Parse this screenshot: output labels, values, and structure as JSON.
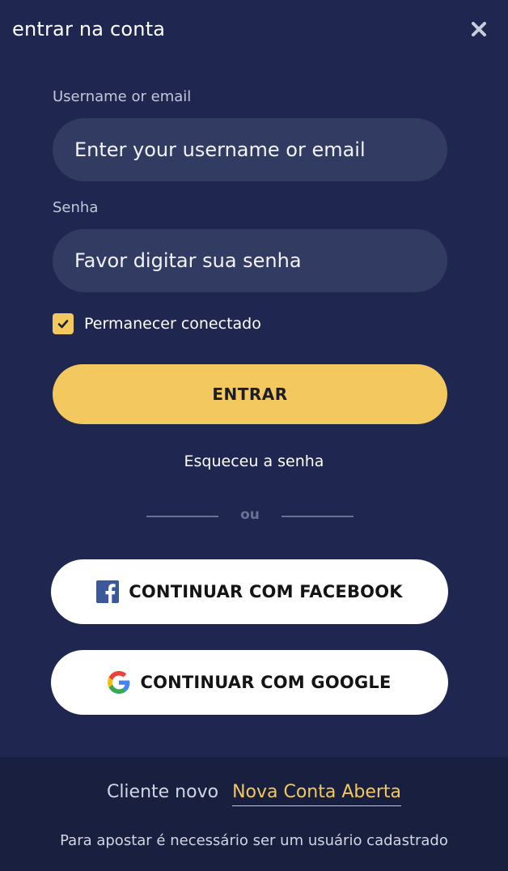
{
  "header": {
    "title": "entrar na conta",
    "close_icon": "close-icon"
  },
  "form": {
    "username_label": "Username or email",
    "username_placeholder": "Enter your username or email",
    "password_label": "Senha",
    "password_placeholder": "Favor digitar sua senha",
    "remember_label": "Permanecer conectado",
    "remember_checked": true,
    "submit_label": "ENTRAR",
    "forgot_label": "Esqueceu a senha"
  },
  "divider": {
    "label": "ou"
  },
  "social": {
    "facebook_label": "CONTINUAR COM FACEBOOK",
    "google_label": "CONTINUAR COM GOOGLE"
  },
  "footer": {
    "new_client_label": "Cliente novo",
    "new_account_link": "Nova Conta Aberta",
    "info_text": "Para apostar é necessário ser um usuário  cadastrado"
  },
  "colors": {
    "background": "#1f2750",
    "input_bg": "#323b62",
    "accent": "#f3c85e",
    "footer_bg": "#19203f"
  }
}
